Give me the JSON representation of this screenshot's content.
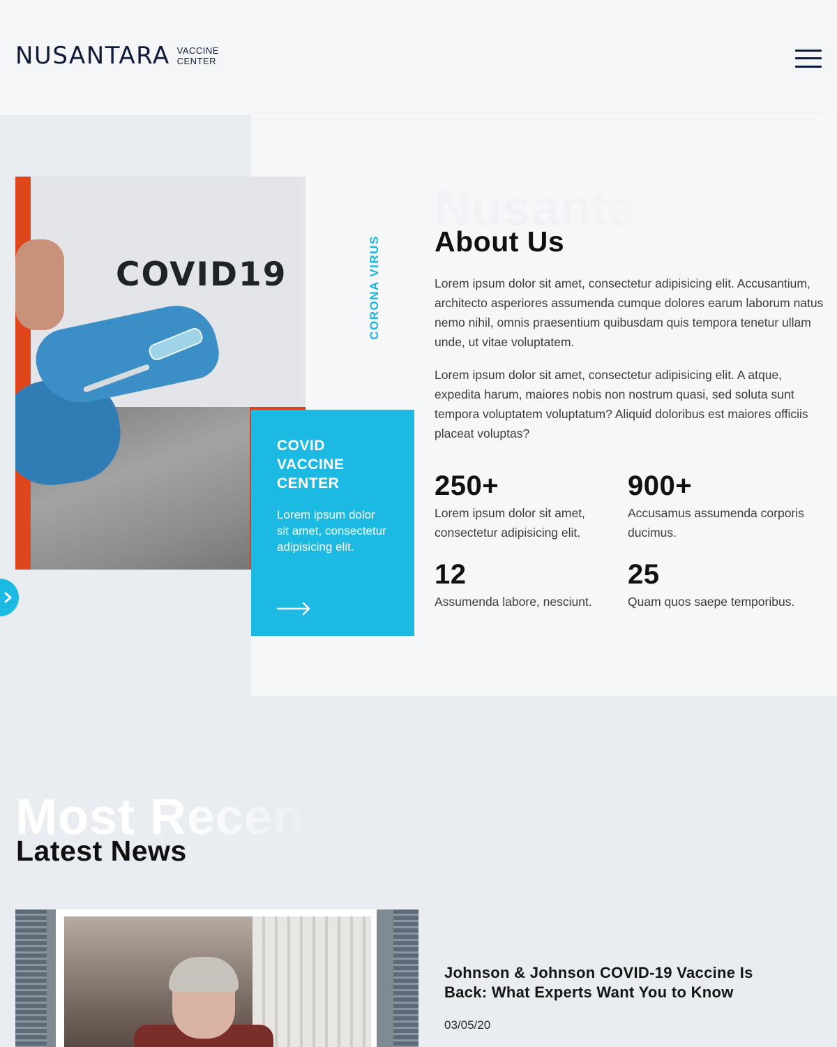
{
  "header": {
    "logo_main": "NUSANTARA",
    "logo_sub_line1": "VACCINE",
    "logo_sub_line2": "CENTER",
    "menu_icon": "hamburger-menu-icon"
  },
  "about": {
    "ghost_word": "Nusantara",
    "title": "About Us",
    "vertical_label": "CORONA VIRUS",
    "image_text": "COVID19",
    "paragraph1": "Lorem ipsum dolor sit amet, consectetur adipisicing elit. Accusantium, architecto asperiores assumenda cumque dolores earum laborum natus nemo nihil, omnis praesentium quibusdam quis tempora tenetur ullam unde, ut vitae voluptatem.",
    "paragraph2": "Lorem ipsum dolor sit amet, consectetur adipisicing elit. A atque, expedita harum, maiores nobis non nostrum quasi, sed soluta sunt tempora voluptatem voluptatum? Aliquid doloribus est maiores officiis placeat voluptas?",
    "card": {
      "title": "COVID VACCINE CENTER",
      "text": "Lorem ipsum dolor sit amet, consectetur adipisicing elit.",
      "arrow_icon": "arrow-right-icon",
      "color": "#1cb9e3"
    },
    "slider_icon": "chevron-right-icon",
    "stats": [
      {
        "number": "250+",
        "description": "Lorem ipsum dolor sit amet, consectetur adipisicing elit."
      },
      {
        "number": "900+",
        "description": "Accusamus assumenda corporis ducimus."
      },
      {
        "number": "12",
        "description": "Assumenda labore, nesciunt."
      },
      {
        "number": "25",
        "description": "Quam quos saepe temporibus."
      }
    ]
  },
  "news": {
    "ghost_word": "Most Recent",
    "title": "Latest News",
    "items": [
      {
        "headline": "Johnson & Johnson COVID-19 Vaccine Is Back: What Experts Want You to Know",
        "date": "03/05/20"
      }
    ]
  },
  "colors": {
    "accent": "#1cb9e3",
    "navy": "#101a3a",
    "page_bg": "#e9edf2",
    "panel_bg": "#f6f7f9"
  }
}
